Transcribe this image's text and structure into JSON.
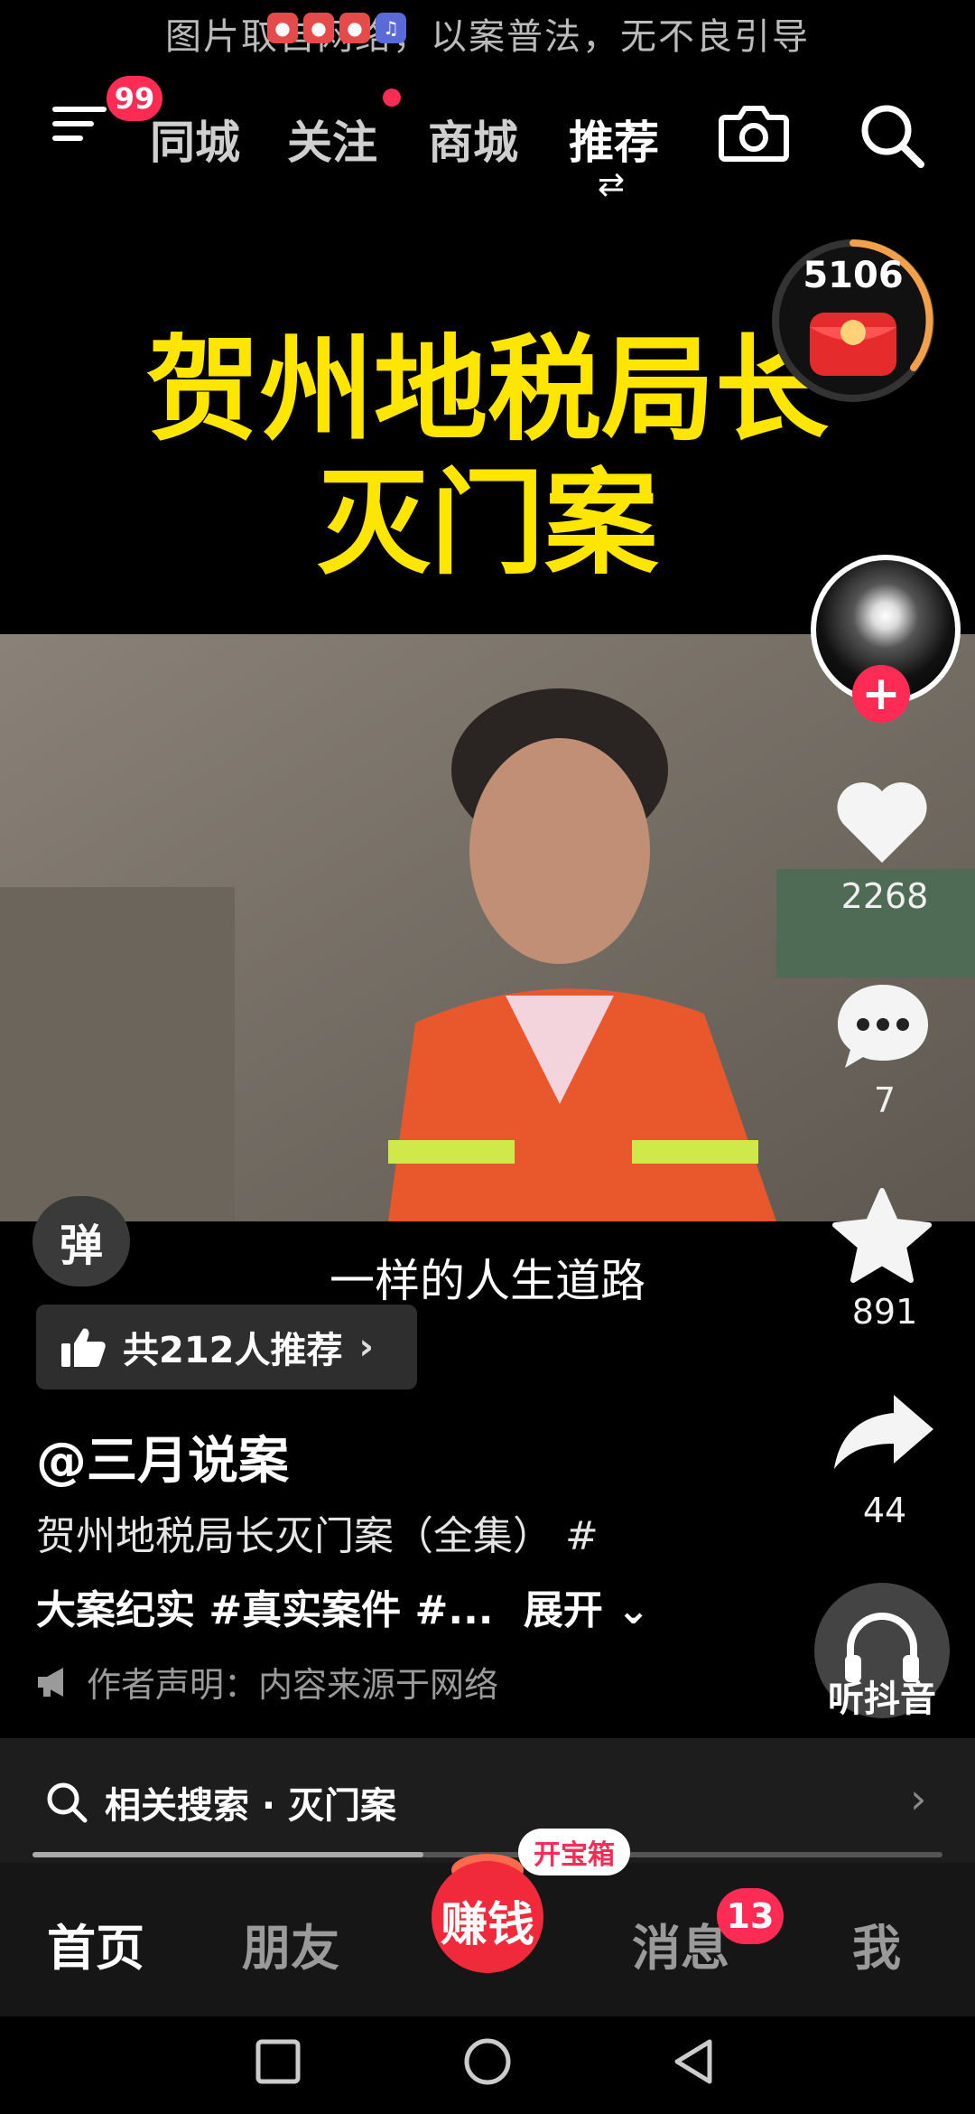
{
  "watermark": "图片取自网络，以案普法，无不良引导",
  "top_nav": {
    "menu_badge": "99",
    "tabs": [
      {
        "label": "同城",
        "active": false
      },
      {
        "label": "关注",
        "active": false,
        "dot": true
      },
      {
        "label": "商城",
        "active": false
      },
      {
        "label": "推荐",
        "active": true
      }
    ],
    "icons": [
      "menu-icon",
      "camera-icon",
      "search-icon",
      "swap-icon"
    ]
  },
  "video": {
    "title_line1": "贺州地税局长",
    "title_line2": "灭门案",
    "subtitle": "一样的人生道路"
  },
  "right_rail": {
    "coin_count": "5106",
    "like_count": "2268",
    "comment_count": "7",
    "favorite_count": "891",
    "share_count": "44",
    "listen_label": "听抖音"
  },
  "danmu_label": "弹",
  "recommend_chip": "共212人推荐",
  "author": "@三月说案",
  "description": {
    "line1": "贺州地税局长灭门案（全集） #",
    "line2": "大案纪实 #真实案件 #...",
    "expand": "展开"
  },
  "declaration": "作者声明：内容来源于网络",
  "related_search": "相关搜索 · 灭门案",
  "progress": 0.43,
  "bottom_nav": {
    "home": "首页",
    "friends": "朋友",
    "earn": "赚钱",
    "treasure_tag": "开宝箱",
    "messages": "消息",
    "messages_badge": "13",
    "me": "我"
  },
  "colors": {
    "accent": "#fe2c55",
    "title_yellow": "#ffe600",
    "background": "#000000"
  }
}
